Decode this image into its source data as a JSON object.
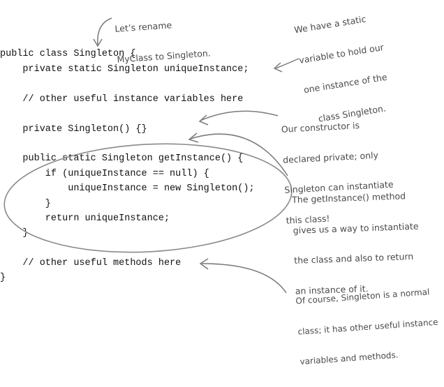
{
  "code": {
    "lines": [
      "public class Singleton {",
      "    private static Singleton uniqueInstance;",
      "",
      "    // other useful instance variables here",
      "",
      "    private Singleton() {}",
      "",
      "    public static Singleton getInstance() {",
      "        if (uniqueInstance == null) {",
      "            uniqueInstance = new Singleton();",
      "        }",
      "        return uniqueInstance;",
      "    }",
      "",
      "    // other useful methods here",
      "}"
    ]
  },
  "annotations": {
    "rename": [
      "Let’s rename",
      "MyClass to Singleton."
    ],
    "static_variable": [
      "We have a static",
      "variable to hold our",
      "one instance of the",
      "class Singleton."
    ],
    "constructor": [
      "Our constructor is",
      "declared private; only",
      "Singleton can instantiate",
      "this class!"
    ],
    "get_instance": [
      "The getInstance() method",
      "gives us a way to instantiate",
      "the class and also to return",
      "an instance of it."
    ],
    "normal_class": [
      "Of course, Singleton is a normal",
      "class; it has other useful instance",
      "variables and methods."
    ]
  },
  "colors": {
    "code_text": "#111111",
    "annotation_text": "#4a4a4a",
    "annotation_stroke": "#7a7a7a"
  }
}
